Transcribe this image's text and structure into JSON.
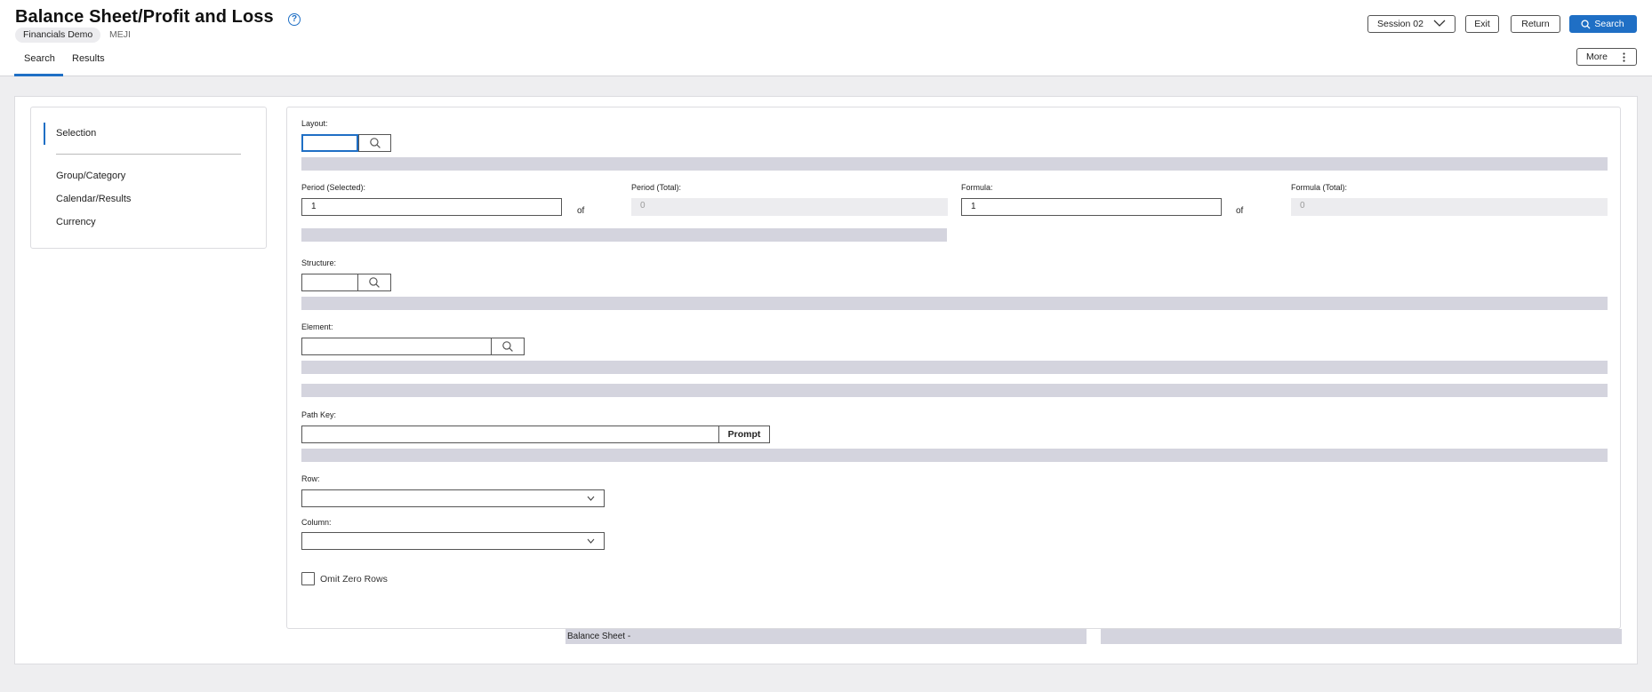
{
  "header": {
    "title": "Balance Sheet/Profit and Loss",
    "help_glyph": "?",
    "environment": "Financials Demo",
    "user": "MEJI",
    "tabs": [
      {
        "label": "Search",
        "active": true
      },
      {
        "label": "Results",
        "active": false
      }
    ],
    "buttons": {
      "session": "Session 02",
      "exit": "Exit",
      "return": "Return",
      "search": "Search",
      "more": "More"
    }
  },
  "sidebar": {
    "items": [
      {
        "label": "Selection",
        "active": true
      },
      {
        "label": "Group/Category",
        "active": false
      },
      {
        "label": "Calendar/Results",
        "active": false
      },
      {
        "label": "Currency",
        "active": false
      }
    ]
  },
  "form": {
    "layout": {
      "label": "Layout:",
      "value": ""
    },
    "period_selected": {
      "label": "Period (Selected):",
      "value": "1"
    },
    "period_total": {
      "label": "Period (Total):",
      "value": "0"
    },
    "formula": {
      "label": "Formula:",
      "value": "1"
    },
    "formula_total": {
      "label": "Formula (Total):",
      "value": "0"
    },
    "of_text": "of",
    "structure": {
      "label": "Structure:",
      "value": ""
    },
    "element": {
      "label": "Element:",
      "value": ""
    },
    "path_key": {
      "label": "Path Key:",
      "value": "",
      "button": "Prompt"
    },
    "row": {
      "label": "Row:",
      "value": ""
    },
    "column": {
      "label": "Column:",
      "value": ""
    },
    "omit_zero_rows": {
      "label": "Omit Zero Rows",
      "checked": false
    }
  },
  "footer": {
    "left_text": "Balance Sheet -",
    "right_text": ""
  },
  "colors": {
    "accent": "#1f6fc5",
    "placeholder_bar": "#d4d4de",
    "background": "#eeeef0"
  }
}
